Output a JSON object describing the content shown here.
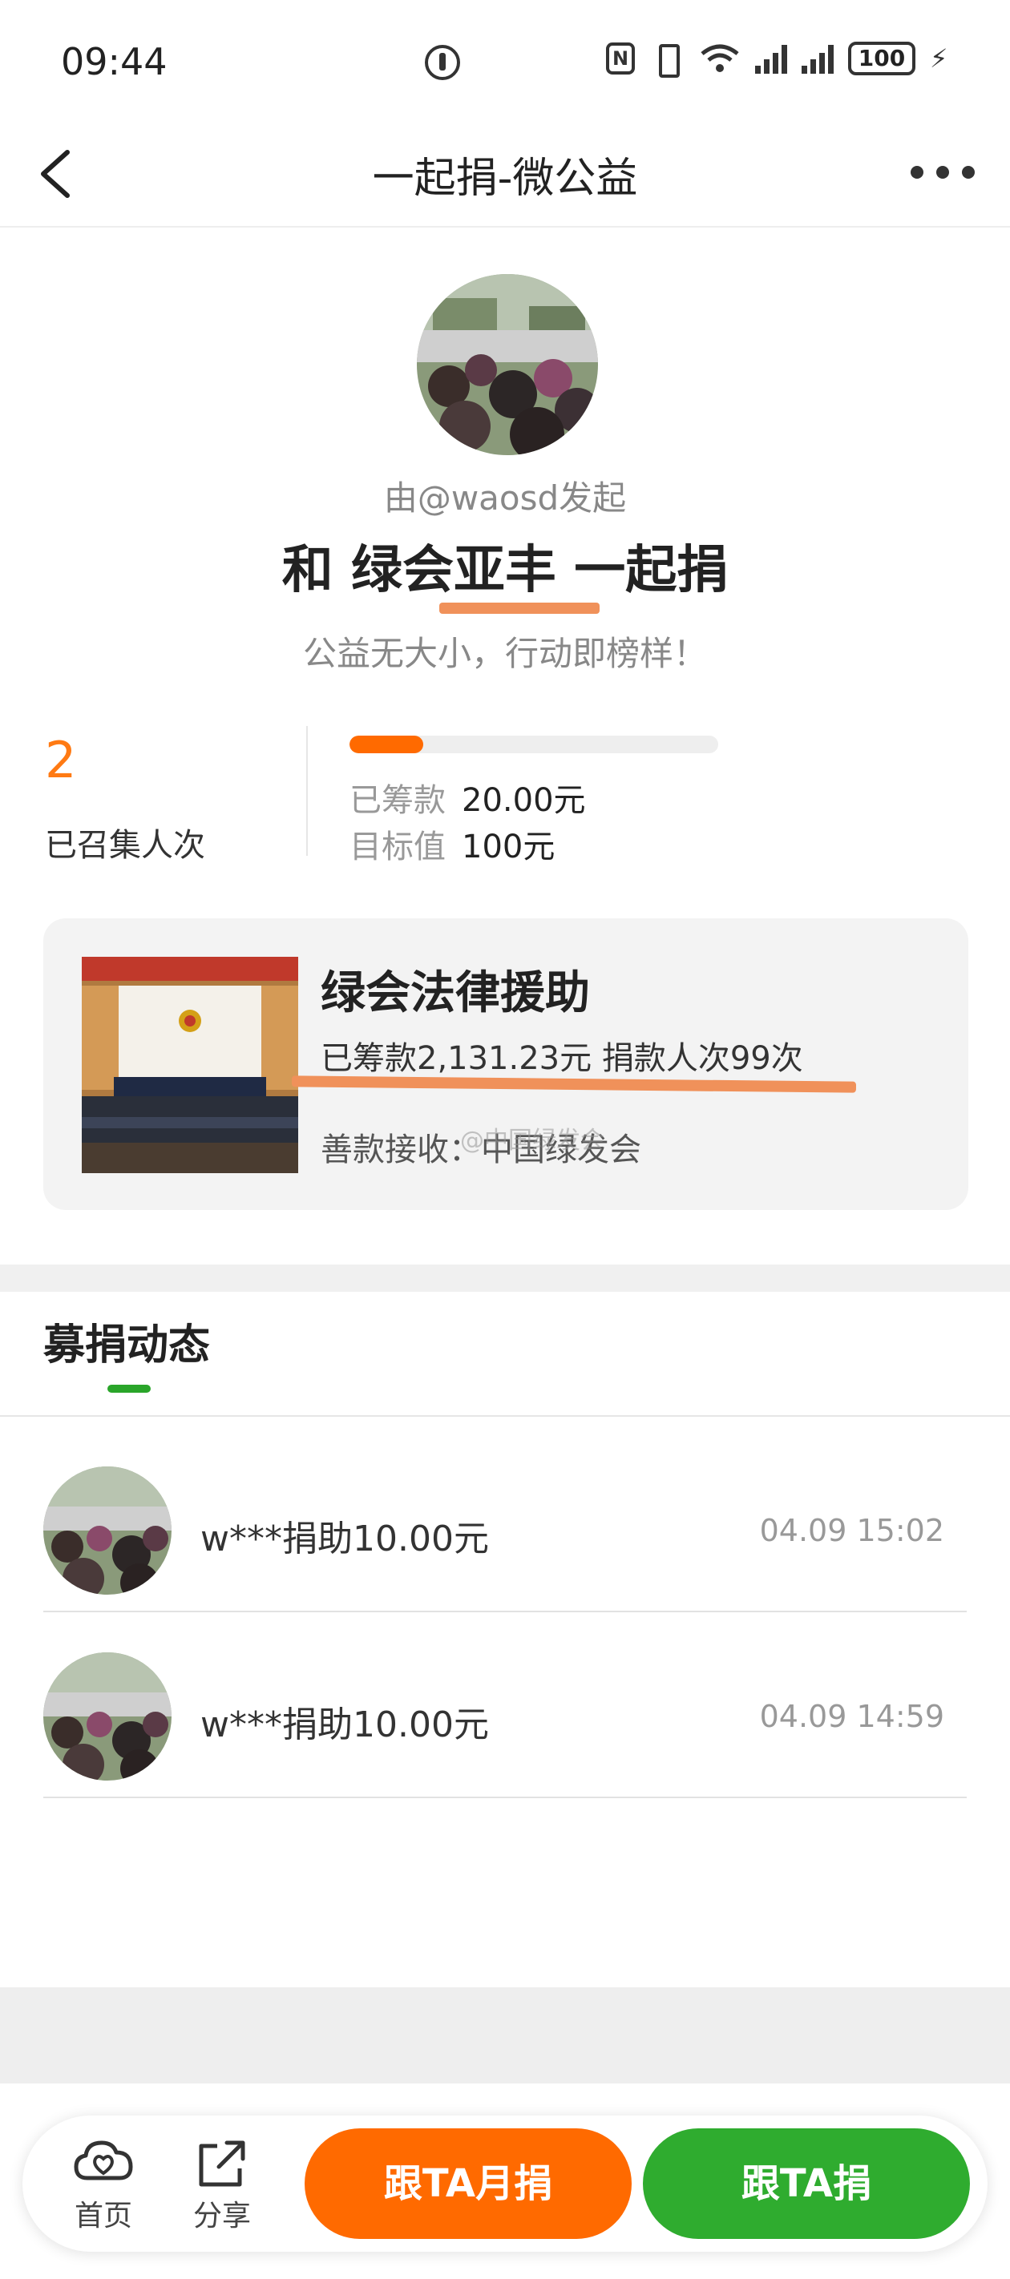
{
  "status_bar": {
    "time": "09:44",
    "battery": "100"
  },
  "nav": {
    "title": "一起捐-微公益"
  },
  "initiator": {
    "by": "由@waosd发起",
    "headline": "和 绿会亚丰 一起捐",
    "slogan": "公益无大小，行动即榜样！"
  },
  "stats": {
    "count": "2",
    "count_label": "已召集人次",
    "raised_label": "已筹款",
    "raised_value": "20.00元",
    "target_label": "目标值",
    "target_value": "100元",
    "progress_fraction": 0.2
  },
  "project": {
    "title": "绿会法律援助",
    "stats": "已筹款2,131.23元  捐款人次99次",
    "receiver": "善款接收：中国绿发会",
    "watermark": "@中国绿发会"
  },
  "feed": {
    "title": "募捐动态",
    "items": [
      {
        "text": "w***捐助10.00元",
        "time": "04.09 15:02"
      },
      {
        "text": "w***捐助10.00元",
        "time": "04.09 14:59"
      }
    ]
  },
  "actions": {
    "home": "首页",
    "share": "分享",
    "monthly": "跟TA月捐",
    "donate": "跟TA捐"
  },
  "colors": {
    "accent_orange": "#ff6a00",
    "accent_green": "#2fac2f"
  }
}
